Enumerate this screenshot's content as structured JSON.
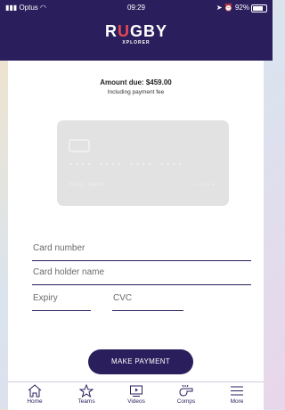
{
  "status_bar": {
    "carrier": "Optus",
    "time": "09:29",
    "battery": "92%"
  },
  "header": {
    "logo_word": "RUGBY",
    "logo_sub": "XPLORER"
  },
  "payment": {
    "amount_due": "Amount due: $459.00",
    "fee_note": "Including payment fee"
  },
  "card_preview": {
    "number_mask": "•••• •••• •••• ••••",
    "name_placeholder": "FULL NAME",
    "expiry_placeholder": "••/••"
  },
  "form": {
    "card_number_placeholder": "Card number",
    "card_holder_placeholder": "Card holder name",
    "expiry_placeholder": "Expiry",
    "cvc_placeholder": "CVC",
    "submit_label": "MAKE PAYMENT"
  },
  "tabs": [
    {
      "label": "Home",
      "icon": "home-icon"
    },
    {
      "label": "Teams",
      "icon": "star-icon"
    },
    {
      "label": "Videos",
      "icon": "play-icon"
    },
    {
      "label": "Comps",
      "icon": "whistle-icon"
    },
    {
      "label": "More",
      "icon": "menu-icon"
    }
  ],
  "colors": {
    "brand_navy": "#2a1f5c",
    "logo_accent": "#e8474f"
  }
}
